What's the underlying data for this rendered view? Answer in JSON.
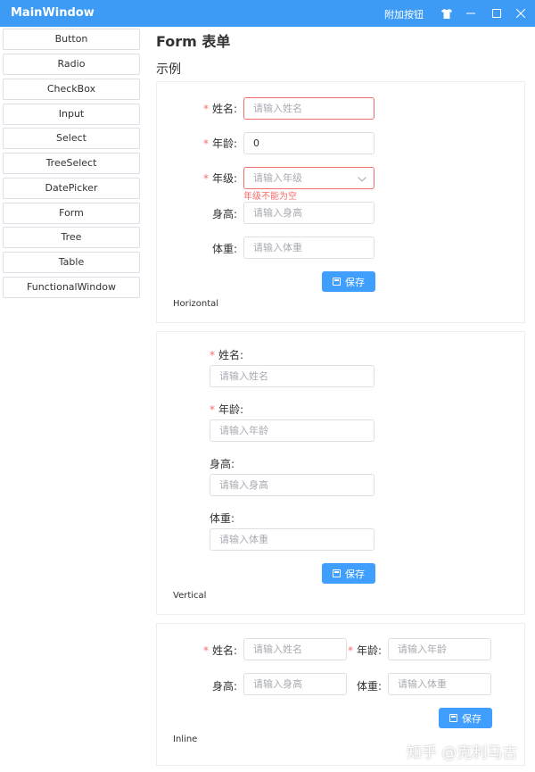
{
  "window": {
    "title": "MainWindow",
    "extra_button": "附加按钮",
    "icons": [
      "tshirt-icon",
      "minimize-icon",
      "maximize-icon",
      "close-icon"
    ]
  },
  "sidebar": {
    "items": [
      {
        "label": "Button"
      },
      {
        "label": "Radio"
      },
      {
        "label": "CheckBox"
      },
      {
        "label": "Input"
      },
      {
        "label": "Select"
      },
      {
        "label": "TreeSelect"
      },
      {
        "label": "DatePicker"
      },
      {
        "label": "Form"
      },
      {
        "label": "Tree"
      },
      {
        "label": "Table"
      },
      {
        "label": "FunctionalWindow"
      }
    ]
  },
  "main": {
    "heading": "Form 表单",
    "subheading": "示例"
  },
  "horizontal_form": {
    "name_label": "姓名:",
    "name_placeholder": "请输入姓名",
    "age_label": "年龄:",
    "age_value": "0",
    "grade_label": "年级:",
    "grade_placeholder": "请输入年级",
    "grade_error": "年级不能为空",
    "height_label": "身高:",
    "height_placeholder": "请输入身高",
    "weight_label": "体重:",
    "weight_placeholder": "请输入体重",
    "save_label": "保存",
    "mode_label": "Horizontal"
  },
  "vertical_form": {
    "name_label": "姓名:",
    "name_placeholder": "请输入姓名",
    "age_label": "年龄:",
    "age_placeholder": "请输入年龄",
    "height_label": "身高:",
    "height_placeholder": "请输入身高",
    "weight_label": "体重:",
    "weight_placeholder": "请输入体重",
    "save_label": "保存",
    "mode_label": "Vertical"
  },
  "inline_form": {
    "name_label": "姓名:",
    "name_placeholder": "请输入姓名",
    "age_label": "年龄:",
    "age_placeholder": "请输入年龄",
    "height_label": "身高:",
    "height_placeholder": "请输入身高",
    "weight_label": "体重:",
    "weight_placeholder": "请输入体重",
    "save_label": "保存",
    "mode_label": "Inline"
  },
  "watermark": "知乎 @克利马古",
  "colors": {
    "titlebar": "#3d9bf5",
    "primary": "#409eff",
    "error": "#f56c6c",
    "placeholder": "#a8abb2",
    "border": "#dcdfe6"
  }
}
